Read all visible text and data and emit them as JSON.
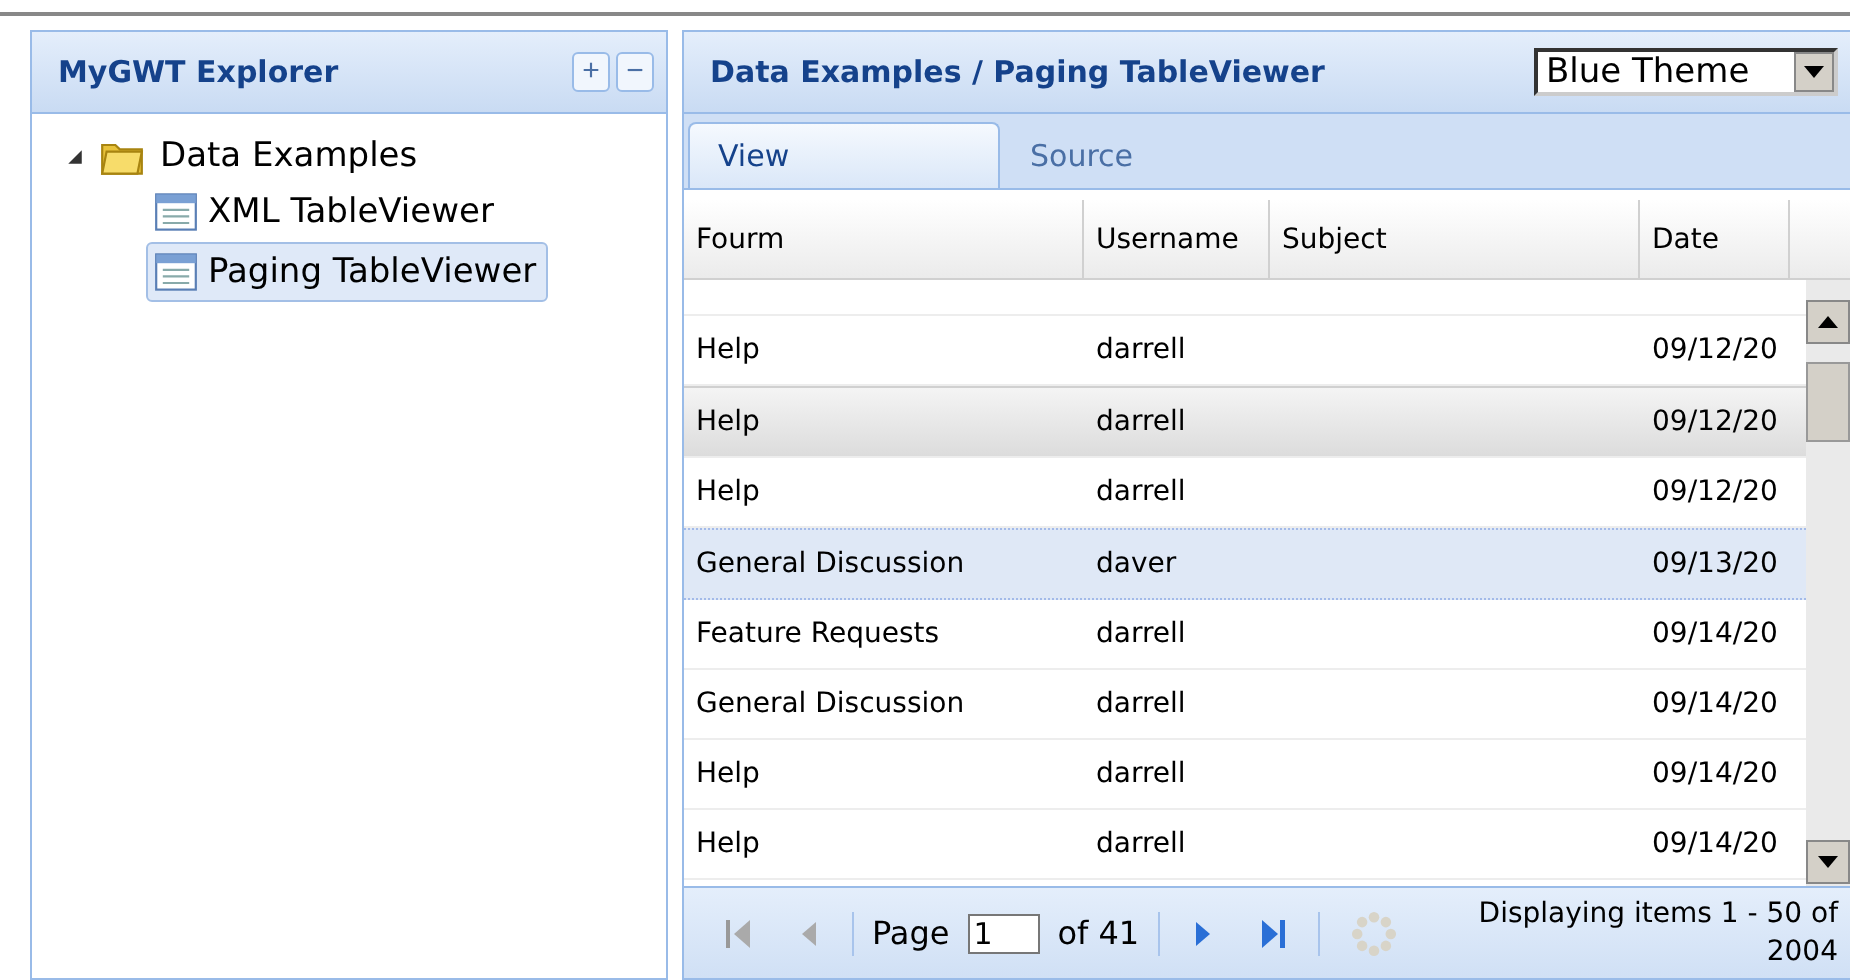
{
  "explorer": {
    "title": "MyGWT Explorer",
    "buttons": [
      "+",
      "−"
    ],
    "tree": [
      {
        "label": "Data Examples",
        "expanded": true,
        "children": [
          {
            "label": "XML TableViewer",
            "selected": false
          },
          {
            "label": "Paging TableViewer",
            "selected": true
          }
        ]
      }
    ]
  },
  "content": {
    "title": "Data Examples / Paging TableViewer",
    "theme_select": {
      "value": "Blue Theme"
    },
    "tabs": [
      {
        "label": "View",
        "selected": true
      },
      {
        "label": "Source",
        "selected": false
      }
    ],
    "table": {
      "columns": [
        "Fourm",
        "Username",
        "Subject",
        "Date"
      ],
      "rows": [
        {
          "cells": [
            "Help",
            "darrell",
            "",
            "09/12/20"
          ],
          "selected": false,
          "hovered": false
        },
        {
          "cells": [
            "Help",
            "darrell",
            "",
            "09/12/20"
          ],
          "selected": false,
          "hovered": true
        },
        {
          "cells": [
            "Help",
            "darrell",
            "",
            "09/12/20"
          ],
          "selected": false,
          "hovered": false
        },
        {
          "cells": [
            "General Discussion",
            "daver",
            "",
            "09/13/20"
          ],
          "selected": true,
          "hovered": false
        },
        {
          "cells": [
            "Feature Requests",
            "darrell",
            "",
            "09/14/20"
          ],
          "selected": false,
          "hovered": false
        },
        {
          "cells": [
            "General Discussion",
            "darrell",
            "",
            "09/14/20"
          ],
          "selected": false,
          "hovered": false
        },
        {
          "cells": [
            "Help",
            "darrell",
            "",
            "09/14/20"
          ],
          "selected": false,
          "hovered": false
        },
        {
          "cells": [
            "Help",
            "darrell",
            "",
            "09/14/20"
          ],
          "selected": false,
          "hovered": false
        }
      ]
    },
    "pager": {
      "page_label": "Page",
      "page_value": "1",
      "of_label": "of 41",
      "status": "Displaying items 1 - 50 of 2004"
    }
  }
}
